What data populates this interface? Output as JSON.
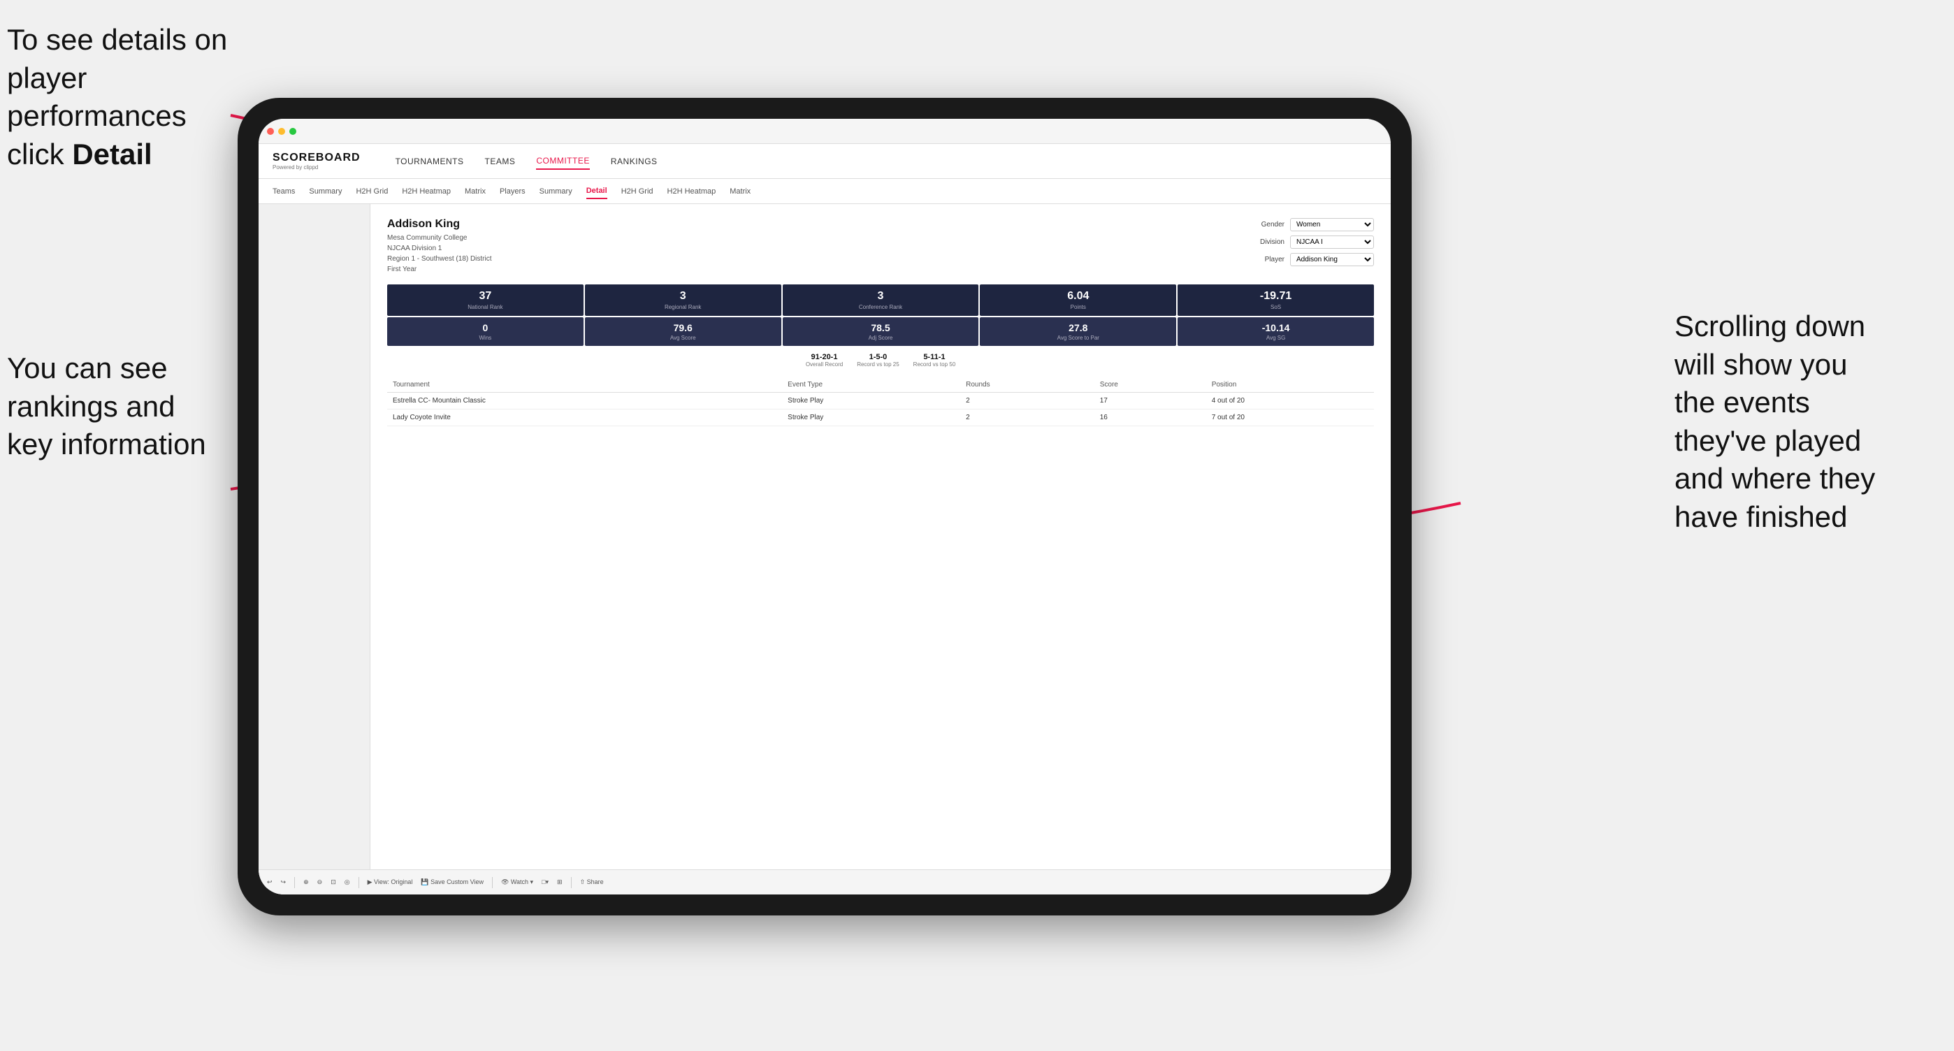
{
  "annotations": {
    "top_left": {
      "line1": "To see details on",
      "line2": "player performances",
      "line3_prefix": "click ",
      "line3_bold": "Detail"
    },
    "bottom_left": {
      "line1": "You can see",
      "line2": "rankings and",
      "line3": "key information"
    },
    "right": {
      "line1": "Scrolling down",
      "line2": "will show you",
      "line3": "the events",
      "line4": "they've played",
      "line5": "and where they",
      "line6": "have finished"
    }
  },
  "nav": {
    "logo_title": "SCOREBOARD",
    "logo_sub": "Powered by clippd",
    "items": [
      "TOURNAMENTS",
      "TEAMS",
      "COMMITTEE",
      "RANKINGS"
    ],
    "active": "COMMITTEE"
  },
  "sub_nav": {
    "items": [
      "Teams",
      "Summary",
      "H2H Grid",
      "H2H Heatmap",
      "Matrix",
      "Players",
      "Summary",
      "Detail",
      "H2H Grid",
      "H2H Heatmap",
      "Matrix"
    ],
    "active": "Detail"
  },
  "player": {
    "name": "Addison King",
    "school": "Mesa Community College",
    "division": "NJCAA Division 1",
    "region": "Region 1 - Southwest (18) District",
    "year": "First Year"
  },
  "controls": {
    "gender_label": "Gender",
    "gender_value": "Women",
    "division_label": "Division",
    "division_value": "NJCAA I",
    "player_label": "Player",
    "player_value": "Addison King"
  },
  "stats_row1": [
    {
      "value": "37",
      "label": "National Rank"
    },
    {
      "value": "3",
      "label": "Regional Rank"
    },
    {
      "value": "3",
      "label": "Conference Rank"
    },
    {
      "value": "6.04",
      "label": "Points"
    },
    {
      "value": "-19.71",
      "label": "SoS"
    }
  ],
  "stats_row2": [
    {
      "value": "0",
      "label": "Wins"
    },
    {
      "value": "79.6",
      "label": "Avg Score"
    },
    {
      "value": "78.5",
      "label": "Adj Score"
    },
    {
      "value": "27.8",
      "label": "Avg Score to Par"
    },
    {
      "value": "-10.14",
      "label": "Avg SG"
    }
  ],
  "records": [
    {
      "value": "91-20-1",
      "label": "Overall Record"
    },
    {
      "value": "1-5-0",
      "label": "Record vs top 25"
    },
    {
      "value": "5-11-1",
      "label": "Record vs top 50"
    }
  ],
  "table": {
    "headers": [
      "Tournament",
      "Event Type",
      "Rounds",
      "Score",
      "Position"
    ],
    "rows": [
      {
        "tournament": "Estrella CC- Mountain Classic",
        "event_type": "Stroke Play",
        "rounds": "2",
        "score": "17",
        "position": "4 out of 20"
      },
      {
        "tournament": "Lady Coyote Invite",
        "event_type": "Stroke Play",
        "rounds": "2",
        "score": "16",
        "position": "7 out of 20"
      }
    ]
  },
  "toolbar": {
    "buttons": [
      "⟲",
      "⟳",
      "⊕",
      "⊖",
      "⊟",
      "⊡",
      "◎",
      "View: Original",
      "Save Custom View",
      "Watch ▾",
      "□▾",
      "⊞",
      "Share"
    ]
  }
}
